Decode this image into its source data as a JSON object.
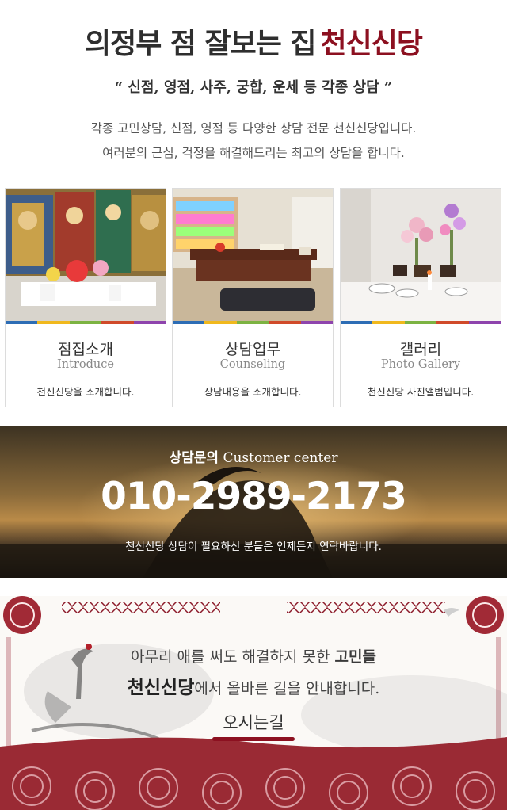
{
  "header": {
    "title_prefix": "의정부 점 잘보는 집",
    "title_brand": "천신신당",
    "subtitle": "“ 신점, 영점, 사주, 궁합, 운세 등 각종 상담 ”",
    "desc_line1": "각종 고민상담, 신점, 영점 등 다양한 상담 전문 천신신당입니다.",
    "desc_line2": "여러분의 근심, 걱정을 해결해드리는 최고의 상담을 합니다.",
    "brand_color": "#8c1020"
  },
  "cards": [
    {
      "title_ko": "점집소개",
      "title_en": "Introduce",
      "caption": "천신신당을 소개합니다."
    },
    {
      "title_ko": "상담업무",
      "title_en": "Counseling",
      "caption": "상담내용을 소개합니다."
    },
    {
      "title_ko": "갤러리",
      "title_en": "Photo Gallery",
      "caption": "천신신당 사진앨범입니다."
    }
  ],
  "stripe_colors": [
    "#2d6db5",
    "#f0b81d",
    "#7cb342",
    "#d04a2a",
    "#8e44ad"
  ],
  "contact": {
    "label_ko": "상담문의",
    "label_en": "Customer center",
    "phone": "010-2989-2173",
    "note": "천신신당 상담이 필요하신 분들은 언제든지 연락바랍니다."
  },
  "guide": {
    "line1_prefix": "아무리 애를 써도 해결하지 못한 ",
    "line1_emph": "고민들",
    "line2_brand": "천신신당",
    "line2_suffix": "에서 올바른 길을 안내합니다.",
    "button_label": "오시는길"
  }
}
